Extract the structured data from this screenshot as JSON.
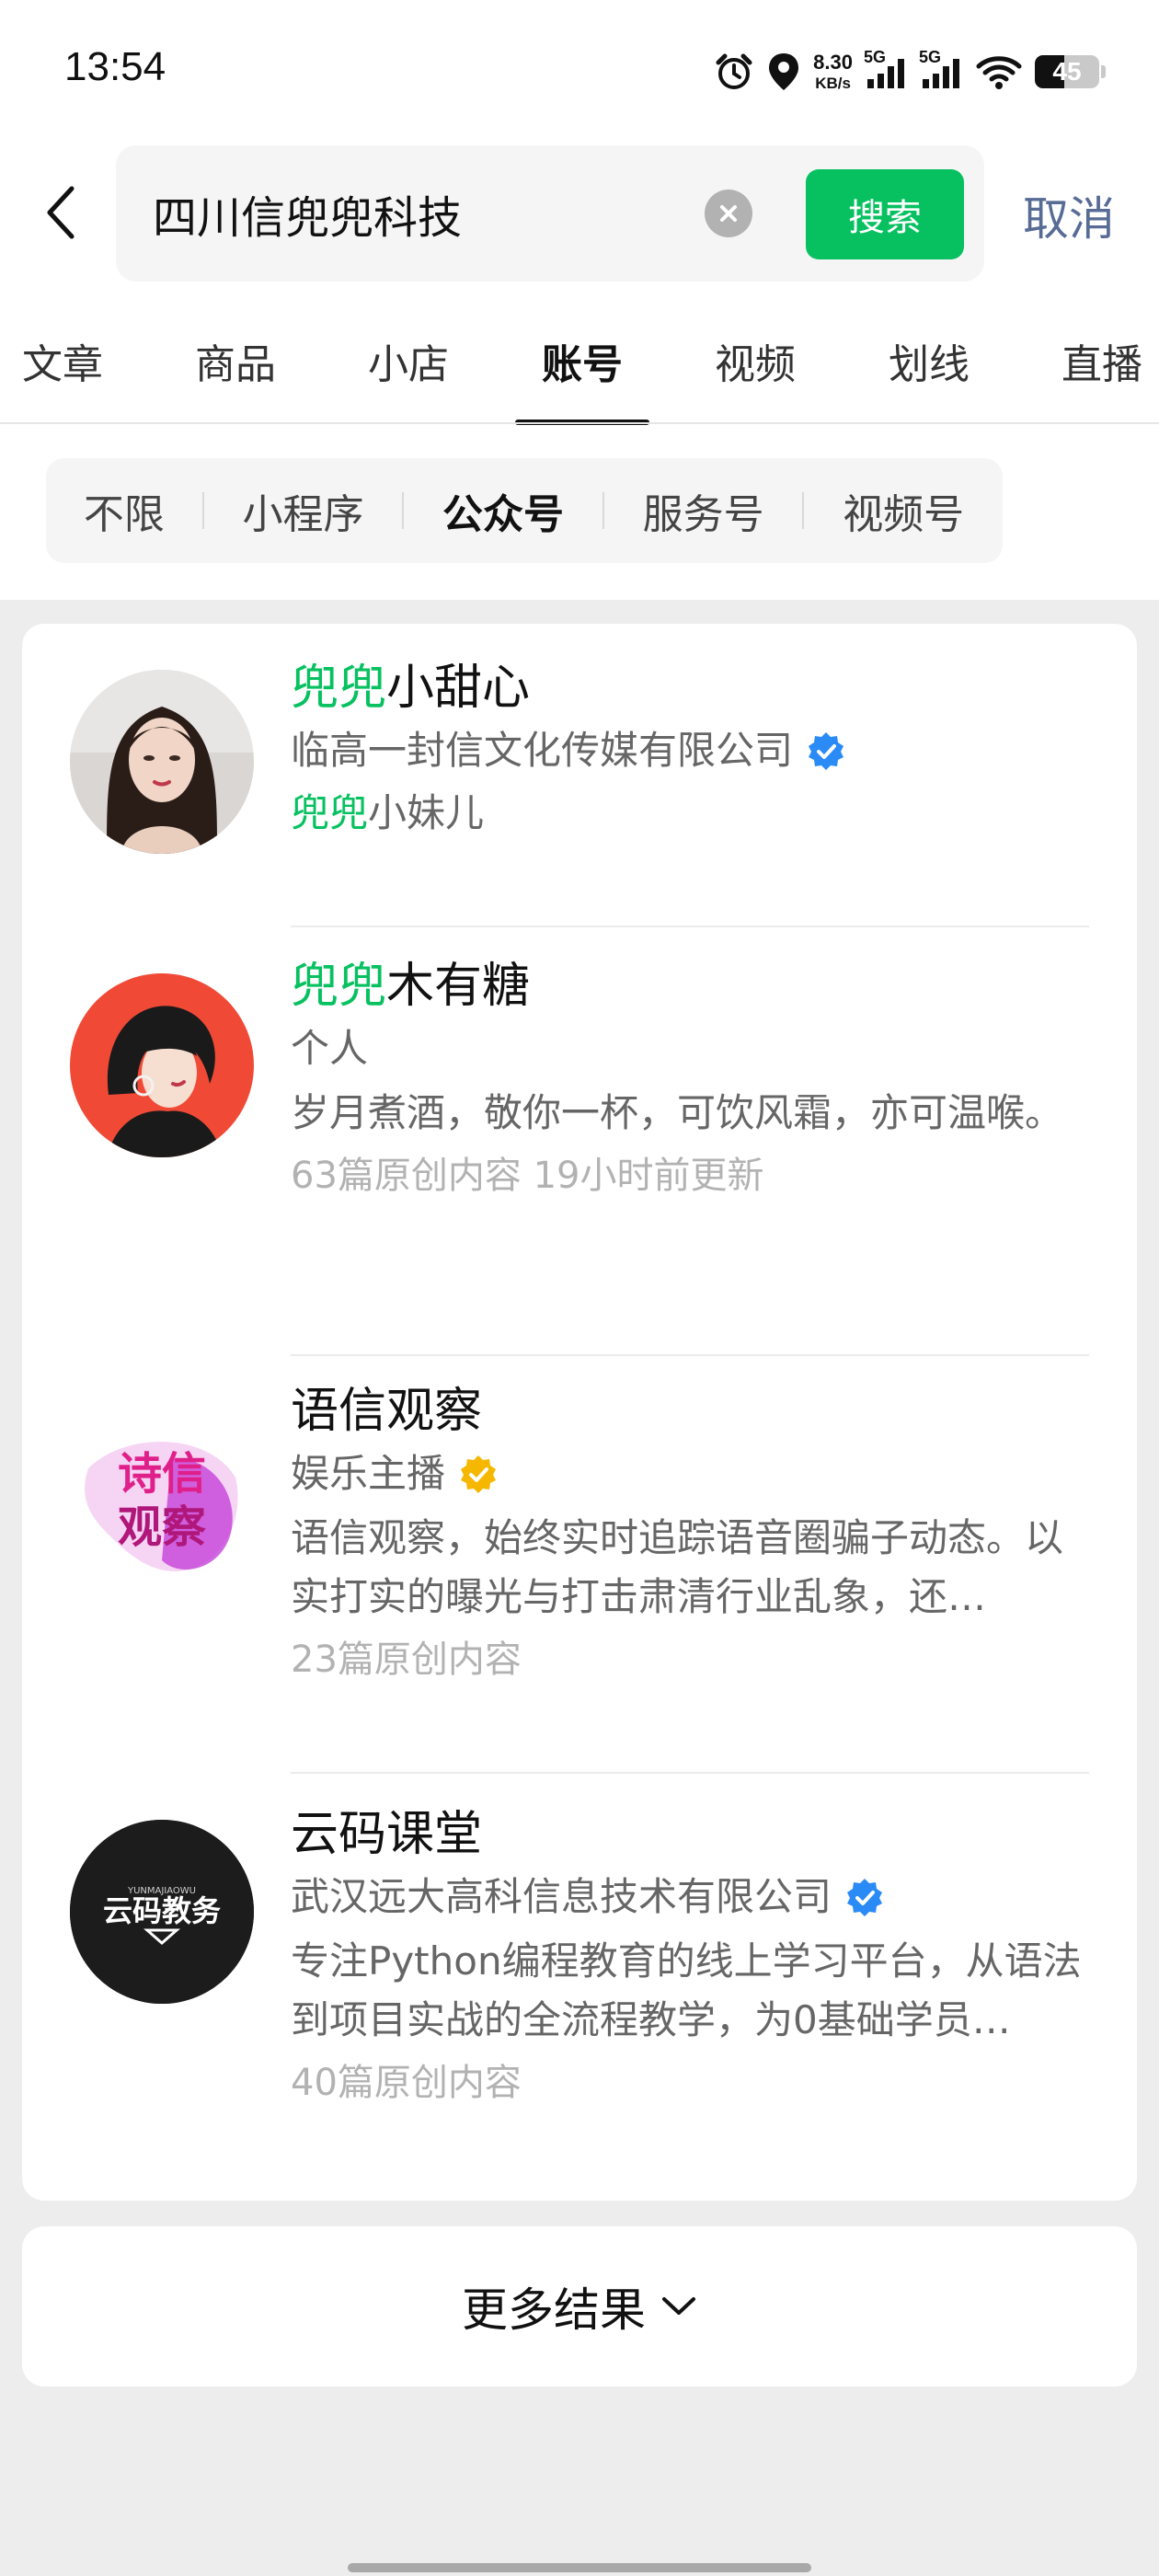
{
  "status_bar": {
    "time": "13:54",
    "net_speed_value": "8.30",
    "net_speed_unit": "KB/s",
    "sim1_label": "5G",
    "sim2_label": "5G",
    "battery_level": "45",
    "icons": [
      "alarm-icon",
      "location-icon",
      "signal-icon",
      "wifi-icon",
      "battery-icon"
    ]
  },
  "search": {
    "query": "四川信兜兜科技",
    "search_button_label": "搜索",
    "cancel_label": "取消"
  },
  "tabs": [
    {
      "label": "文章",
      "active": false
    },
    {
      "label": "商品",
      "active": false
    },
    {
      "label": "小店",
      "active": false
    },
    {
      "label": "账号",
      "active": true
    },
    {
      "label": "视频",
      "active": false
    },
    {
      "label": "划线",
      "active": false
    },
    {
      "label": "直播",
      "active": false
    }
  ],
  "filters": [
    {
      "label": "不限",
      "active": false
    },
    {
      "label": "小程序",
      "active": false
    },
    {
      "label": "公众号",
      "active": true
    },
    {
      "label": "服务号",
      "active": false
    },
    {
      "label": "视频号",
      "active": false
    }
  ],
  "results": [
    {
      "name_highlight": "兜兜",
      "name_rest": "小甜心",
      "subtitle": "临高一封信文化传媒有限公司",
      "verified_color": "#2a8af6",
      "extra_highlight": "兜兜",
      "extra_rest": "小妹儿"
    },
    {
      "name_highlight": "兜兜",
      "name_rest": "木有糖",
      "subtitle": "个人",
      "description": "岁月煮酒，敬你一杯，可饮风霜，亦可温喉。",
      "meta": "63篇原创内容  19小时前更新"
    },
    {
      "name": "语信观察",
      "subtitle": "娱乐主播",
      "verified_color": "#f5b700",
      "avatar_text_line1": "诗信",
      "avatar_text_line2": "观察",
      "description": "语信观察，始终实时追踪语音圈骗子动态。以实打实的曝光与打击肃清行业乱象，还…",
      "meta": "23篇原创内容"
    },
    {
      "name": "云码课堂",
      "subtitle": "武汉远大高科信息技术有限公司",
      "verified_color": "#2a8af6",
      "avatar_top_text": "YUNMAJIAOWU",
      "avatar_text": "云码教务",
      "description": "专注Python编程教育的线上学习平台，从语法到项目实战的全流程教学，为0基础学员…",
      "meta": "40篇原创内容"
    }
  ],
  "more": {
    "label": "更多结果"
  },
  "colors": {
    "accent_green": "#07c160",
    "link_blue": "#576b95",
    "background": "#ededed"
  }
}
